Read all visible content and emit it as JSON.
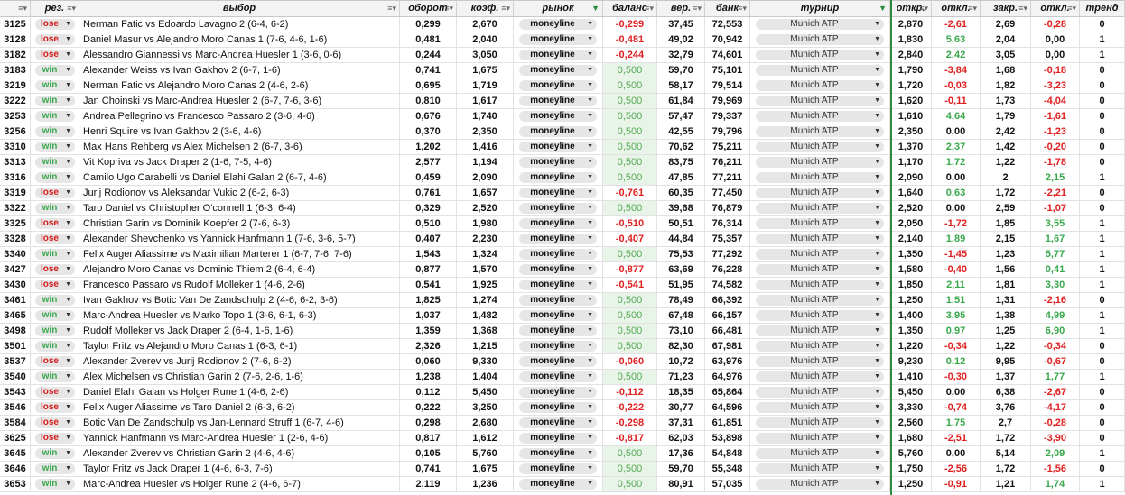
{
  "colors": {
    "accent": "#2e8b3c",
    "negative": "#e02020",
    "positive": "#3aa84d"
  },
  "header": {
    "id": "",
    "result": "рез.",
    "selection": "выбор",
    "turnover": "оборот",
    "odds": "коэф.",
    "market": "рынок",
    "balance": "баланс",
    "prob": "вер.",
    "bank": "банк",
    "tournament": "турнир",
    "open": "откр.",
    "dev1": "откл.",
    "close": "закр.",
    "dev2": "откл.",
    "trend": "тренд"
  },
  "rows": [
    {
      "id": "3125",
      "res": "lose",
      "sel": "Nerman Fatic vs Edoardo Lavagno 2 (6-4, 6-2)",
      "turn": "0,299",
      "odds": "2,670",
      "mkt": "moneyline",
      "bal": "-0,299",
      "prob": "37,45",
      "bank": "72,553",
      "trn": "Munich ATP",
      "open": "2,870",
      "d1": "-2,61",
      "close": "2,69",
      "d2": "-0,28",
      "trend": "0"
    },
    {
      "id": "3128",
      "res": "lose",
      "sel": "Daniel Masur vs Alejandro Moro Canas 1 (7-6, 4-6, 1-6)",
      "turn": "0,481",
      "odds": "2,040",
      "mkt": "moneyline",
      "bal": "-0,481",
      "prob": "49,02",
      "bank": "70,942",
      "trn": "Munich ATP",
      "open": "1,830",
      "d1": "5,63",
      "close": "2,04",
      "d2": "0,00",
      "trend": "1"
    },
    {
      "id": "3182",
      "res": "lose",
      "sel": "Alessandro Giannessi vs Marc-Andrea Huesler 1 (3-6, 0-6)",
      "turn": "0,244",
      "odds": "3,050",
      "mkt": "moneyline",
      "bal": "-0,244",
      "prob": "32,79",
      "bank": "74,601",
      "trn": "Munich ATP",
      "open": "2,840",
      "d1": "2,42",
      "close": "3,05",
      "d2": "0,00",
      "trend": "1"
    },
    {
      "id": "3183",
      "res": "win",
      "sel": "Alexander Weiss vs Ivan Gakhov 2 (6-7, 1-6)",
      "turn": "0,741",
      "odds": "1,675",
      "mkt": "moneyline",
      "bal": "0,500",
      "prob": "59,70",
      "bank": "75,101",
      "trn": "Munich ATP",
      "open": "1,790",
      "d1": "-3,84",
      "close": "1,68",
      "d2": "-0,18",
      "trend": "0"
    },
    {
      "id": "3219",
      "res": "win",
      "sel": "Nerman Fatic vs Alejandro Moro Canas 2 (4-6, 2-6)",
      "turn": "0,695",
      "odds": "1,719",
      "mkt": "moneyline",
      "bal": "0,500",
      "prob": "58,17",
      "bank": "79,514",
      "trn": "Munich ATP",
      "open": "1,720",
      "d1": "-0,03",
      "close": "1,82",
      "d2": "-3,23",
      "trend": "0"
    },
    {
      "id": "3222",
      "res": "win",
      "sel": "Jan Choinski vs Marc-Andrea Huesler 2 (6-7, 7-6, 3-6)",
      "turn": "0,810",
      "odds": "1,617",
      "mkt": "moneyline",
      "bal": "0,500",
      "prob": "61,84",
      "bank": "79,969",
      "trn": "Munich ATP",
      "open": "1,620",
      "d1": "-0,11",
      "close": "1,73",
      "d2": "-4,04",
      "trend": "0"
    },
    {
      "id": "3253",
      "res": "win",
      "sel": "Andrea Pellegrino vs Francesco Passaro 2 (3-6, 4-6)",
      "turn": "0,676",
      "odds": "1,740",
      "mkt": "moneyline",
      "bal": "0,500",
      "prob": "57,47",
      "bank": "79,337",
      "trn": "Munich ATP",
      "open": "1,610",
      "d1": "4,64",
      "close": "1,79",
      "d2": "-1,61",
      "trend": "0"
    },
    {
      "id": "3256",
      "res": "win",
      "sel": "Henri Squire vs Ivan Gakhov 2 (3-6, 4-6)",
      "turn": "0,370",
      "odds": "2,350",
      "mkt": "moneyline",
      "bal": "0,500",
      "prob": "42,55",
      "bank": "79,796",
      "trn": "Munich ATP",
      "open": "2,350",
      "d1": "0,00",
      "close": "2,42",
      "d2": "-1,23",
      "trend": "0"
    },
    {
      "id": "3310",
      "res": "win",
      "sel": "Max Hans Rehberg vs Alex Michelsen 2 (6-7, 3-6)",
      "turn": "1,202",
      "odds": "1,416",
      "mkt": "moneyline",
      "bal": "0,500",
      "prob": "70,62",
      "bank": "75,211",
      "trn": "Munich ATP",
      "open": "1,370",
      "d1": "2,37",
      "close": "1,42",
      "d2": "-0,20",
      "trend": "0"
    },
    {
      "id": "3313",
      "res": "win",
      "sel": "Vit Kopriva vs Jack Draper 2 (1-6, 7-5, 4-6)",
      "turn": "2,577",
      "odds": "1,194",
      "mkt": "moneyline",
      "bal": "0,500",
      "prob": "83,75",
      "bank": "76,211",
      "trn": "Munich ATP",
      "open": "1,170",
      "d1": "1,72",
      "close": "1,22",
      "d2": "-1,78",
      "trend": "0"
    },
    {
      "id": "3316",
      "res": "win",
      "sel": "Camilo Ugo Carabelli vs Daniel Elahi Galan 2 (6-7, 4-6)",
      "turn": "0,459",
      "odds": "2,090",
      "mkt": "moneyline",
      "bal": "0,500",
      "prob": "47,85",
      "bank": "77,211",
      "trn": "Munich ATP",
      "open": "2,090",
      "d1": "0,00",
      "close": "2",
      "d2": "2,15",
      "trend": "1"
    },
    {
      "id": "3319",
      "res": "lose",
      "sel": "Jurij Rodionov vs Aleksandar Vukic 2 (6-2, 6-3)",
      "turn": "0,761",
      "odds": "1,657",
      "mkt": "moneyline",
      "bal": "-0,761",
      "prob": "60,35",
      "bank": "77,450",
      "trn": "Munich ATP",
      "open": "1,640",
      "d1": "0,63",
      "close": "1,72",
      "d2": "-2,21",
      "trend": "0"
    },
    {
      "id": "3322",
      "res": "win",
      "sel": "Taro Daniel vs Christopher O'connell 1 (6-3, 6-4)",
      "turn": "0,329",
      "odds": "2,520",
      "mkt": "moneyline",
      "bal": "0,500",
      "prob": "39,68",
      "bank": "76,879",
      "trn": "Munich ATP",
      "open": "2,520",
      "d1": "0,00",
      "close": "2,59",
      "d2": "-1,07",
      "trend": "0"
    },
    {
      "id": "3325",
      "res": "lose",
      "sel": "Christian Garin vs Dominik Koepfer 2 (7-6, 6-3)",
      "turn": "0,510",
      "odds": "1,980",
      "mkt": "moneyline",
      "bal": "-0,510",
      "prob": "50,51",
      "bank": "76,314",
      "trn": "Munich ATP",
      "open": "2,050",
      "d1": "-1,72",
      "close": "1,85",
      "d2": "3,55",
      "trend": "1"
    },
    {
      "id": "3328",
      "res": "lose",
      "sel": "Alexander Shevchenko vs Yannick Hanfmann 1 (7-6, 3-6, 5-7)",
      "turn": "0,407",
      "odds": "2,230",
      "mkt": "moneyline",
      "bal": "-0,407",
      "prob": "44,84",
      "bank": "75,357",
      "trn": "Munich ATP",
      "open": "2,140",
      "d1": "1,89",
      "close": "2,15",
      "d2": "1,67",
      "trend": "1"
    },
    {
      "id": "3340",
      "res": "win",
      "sel": "Felix Auger Aliassime vs Maximilian Marterer 1 (6-7, 7-6, 7-6)",
      "turn": "1,543",
      "odds": "1,324",
      "mkt": "moneyline",
      "bal": "0,500",
      "prob": "75,53",
      "bank": "77,292",
      "trn": "Munich ATP",
      "open": "1,350",
      "d1": "-1,45",
      "close": "1,23",
      "d2": "5,77",
      "trend": "1"
    },
    {
      "id": "3427",
      "res": "lose",
      "sel": "Alejandro Moro Canas vs Dominic Thiem 2 (6-4, 6-4)",
      "turn": "0,877",
      "odds": "1,570",
      "mkt": "moneyline",
      "bal": "-0,877",
      "prob": "63,69",
      "bank": "76,228",
      "trn": "Munich ATP",
      "open": "1,580",
      "d1": "-0,40",
      "close": "1,56",
      "d2": "0,41",
      "trend": "1"
    },
    {
      "id": "3430",
      "res": "lose",
      "sel": "Francesco Passaro vs Rudolf Molleker 1 (4-6, 2-6)",
      "turn": "0,541",
      "odds": "1,925",
      "mkt": "moneyline",
      "bal": "-0,541",
      "prob": "51,95",
      "bank": "74,582",
      "trn": "Munich ATP",
      "open": "1,850",
      "d1": "2,11",
      "close": "1,81",
      "d2": "3,30",
      "trend": "1"
    },
    {
      "id": "3461",
      "res": "win",
      "sel": "Ivan Gakhov vs Botic Van De Zandschulp 2 (4-6, 6-2, 3-6)",
      "turn": "1,825",
      "odds": "1,274",
      "mkt": "moneyline",
      "bal": "0,500",
      "prob": "78,49",
      "bank": "66,392",
      "trn": "Munich ATP",
      "open": "1,250",
      "d1": "1,51",
      "close": "1,31",
      "d2": "-2,16",
      "trend": "0"
    },
    {
      "id": "3465",
      "res": "win",
      "sel": "Marc-Andrea Huesler vs Marko Topo 1 (3-6, 6-1, 6-3)",
      "turn": "1,037",
      "odds": "1,482",
      "mkt": "moneyline",
      "bal": "0,500",
      "prob": "67,48",
      "bank": "66,157",
      "trn": "Munich ATP",
      "open": "1,400",
      "d1": "3,95",
      "close": "1,38",
      "d2": "4,99",
      "trend": "1"
    },
    {
      "id": "3498",
      "res": "win",
      "sel": "Rudolf Molleker vs Jack Draper 2 (6-4, 1-6, 1-6)",
      "turn": "1,359",
      "odds": "1,368",
      "mkt": "moneyline",
      "bal": "0,500",
      "prob": "73,10",
      "bank": "66,481",
      "trn": "Munich ATP",
      "open": "1,350",
      "d1": "0,97",
      "close": "1,25",
      "d2": "6,90",
      "trend": "1"
    },
    {
      "id": "3501",
      "res": "win",
      "sel": "Taylor Fritz vs Alejandro Moro Canas 1 (6-3, 6-1)",
      "turn": "2,326",
      "odds": "1,215",
      "mkt": "moneyline",
      "bal": "0,500",
      "prob": "82,30",
      "bank": "67,981",
      "trn": "Munich ATP",
      "open": "1,220",
      "d1": "-0,34",
      "close": "1,22",
      "d2": "-0,34",
      "trend": "0"
    },
    {
      "id": "3537",
      "res": "lose",
      "sel": "Alexander Zverev vs Jurij Rodionov 2 (7-6, 6-2)",
      "turn": "0,060",
      "odds": "9,330",
      "mkt": "moneyline",
      "bal": "-0,060",
      "prob": "10,72",
      "bank": "63,976",
      "trn": "Munich ATP",
      "open": "9,230",
      "d1": "0,12",
      "close": "9,95",
      "d2": "-0,67",
      "trend": "0"
    },
    {
      "id": "3540",
      "res": "win",
      "sel": "Alex Michelsen vs Christian Garin 2 (7-6, 2-6, 1-6)",
      "turn": "1,238",
      "odds": "1,404",
      "mkt": "moneyline",
      "bal": "0,500",
      "prob": "71,23",
      "bank": "64,976",
      "trn": "Munich ATP",
      "open": "1,410",
      "d1": "-0,30",
      "close": "1,37",
      "d2": "1,77",
      "trend": "1"
    },
    {
      "id": "3543",
      "res": "lose",
      "sel": "Daniel Elahi Galan vs Holger Rune 1 (4-6, 2-6)",
      "turn": "0,112",
      "odds": "5,450",
      "mkt": "moneyline",
      "bal": "-0,112",
      "prob": "18,35",
      "bank": "65,864",
      "trn": "Munich ATP",
      "open": "5,450",
      "d1": "0,00",
      "close": "6,38",
      "d2": "-2,67",
      "trend": "0"
    },
    {
      "id": "3546",
      "res": "lose",
      "sel": "Felix Auger Aliassime vs Taro Daniel 2 (6-3, 6-2)",
      "turn": "0,222",
      "odds": "3,250",
      "mkt": "moneyline",
      "bal": "-0,222",
      "prob": "30,77",
      "bank": "64,596",
      "trn": "Munich ATP",
      "open": "3,330",
      "d1": "-0,74",
      "close": "3,76",
      "d2": "-4,17",
      "trend": "0"
    },
    {
      "id": "3584",
      "res": "lose",
      "sel": "Botic Van De Zandschulp vs Jan-Lennard Struff 1 (6-7, 4-6)",
      "turn": "0,298",
      "odds": "2,680",
      "mkt": "moneyline",
      "bal": "-0,298",
      "prob": "37,31",
      "bank": "61,851",
      "trn": "Munich ATP",
      "open": "2,560",
      "d1": "1,75",
      "close": "2,7",
      "d2": "-0,28",
      "trend": "0"
    },
    {
      "id": "3625",
      "res": "lose",
      "sel": "Yannick Hanfmann vs Marc-Andrea Huesler 1 (2-6, 4-6)",
      "turn": "0,817",
      "odds": "1,612",
      "mkt": "moneyline",
      "bal": "-0,817",
      "prob": "62,03",
      "bank": "53,898",
      "trn": "Munich ATP",
      "open": "1,680",
      "d1": "-2,51",
      "close": "1,72",
      "d2": "-3,90",
      "trend": "0"
    },
    {
      "id": "3645",
      "res": "win",
      "sel": "Alexander Zverev vs Christian Garin 2 (4-6, 4-6)",
      "turn": "0,105",
      "odds": "5,760",
      "mkt": "moneyline",
      "bal": "0,500",
      "prob": "17,36",
      "bank": "54,848",
      "trn": "Munich ATP",
      "open": "5,760",
      "d1": "0,00",
      "close": "5,14",
      "d2": "2,09",
      "trend": "1"
    },
    {
      "id": "3646",
      "res": "win",
      "sel": "Taylor Fritz vs Jack Draper 1 (4-6, 6-3, 7-6)",
      "turn": "0,741",
      "odds": "1,675",
      "mkt": "moneyline",
      "bal": "0,500",
      "prob": "59,70",
      "bank": "55,348",
      "trn": "Munich ATP",
      "open": "1,750",
      "d1": "-2,56",
      "close": "1,72",
      "d2": "-1,56",
      "trend": "0"
    },
    {
      "id": "3653",
      "res": "win",
      "sel": "Marc-Andrea Huesler vs Holger Rune 2 (4-6, 6-7)",
      "turn": "2,119",
      "odds": "1,236",
      "mkt": "moneyline",
      "bal": "0,500",
      "prob": "80,91",
      "bank": "57,035",
      "trn": "Munich ATP",
      "open": "1,250",
      "d1": "-0,91",
      "close": "1,21",
      "d2": "1,74",
      "trend": "1"
    }
  ]
}
